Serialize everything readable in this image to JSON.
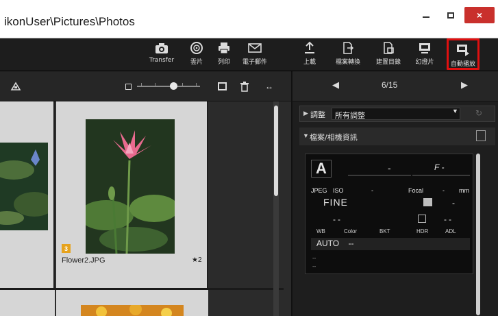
{
  "window": {
    "title": "ikonUser\\Pictures\\Photos",
    "close_glyph": "×"
  },
  "toolbar": {
    "items": [
      {
        "label": "Transfer",
        "icon": "camera-transfer-icon"
      },
      {
        "label": "雲片",
        "icon": "disc-icon"
      },
      {
        "label": "列印",
        "icon": "printer-icon"
      },
      {
        "label": "電子郵件",
        "icon": "mail-icon"
      },
      {
        "label": "上載",
        "icon": "upload-icon"
      },
      {
        "label": "檔案轉換",
        "icon": "file-convert-icon"
      },
      {
        "label": "建置目錄",
        "icon": "create-folder-icon"
      },
      {
        "label": "幻燈片",
        "icon": "slideshow-icon"
      },
      {
        "label": "自動播放",
        "icon": "autoplay-icon",
        "highlighted": true
      }
    ],
    "highlight_color": "#e01010"
  },
  "viewer": {
    "slider_level": 0.55,
    "swap_glyph": "↔"
  },
  "grid": {
    "items": [
      {
        "filename": "Flower2.JPG",
        "rating": "★2",
        "badge": "3"
      }
    ]
  },
  "nav": {
    "prev": "◀",
    "count": "6/15",
    "next": "▶"
  },
  "adjust": {
    "label": "調整",
    "value": "所有調整"
  },
  "fileinfo": {
    "label": "檔案/相機資訊",
    "mode": "A",
    "shutter": "-",
    "aperture": "F -",
    "row2": {
      "format": "JPEG",
      "iso_label": "ISO",
      "iso_value": "-",
      "focal_label": "Focal",
      "focal_value": "-",
      "focal_unit": "mm"
    },
    "quality": "FINE",
    "exp_value": "-",
    "dashes1": "--",
    "dashes2": "--",
    "headers": [
      "WB",
      "Color",
      "BKT",
      "HDR",
      "ADL"
    ],
    "wb": "AUTO",
    "wb_rest": "--",
    "misc": [
      "--",
      "--",
      "--",
      "--"
    ]
  },
  "colors": {
    "toolbar_bg": "#1d1d1d",
    "cell_bg": "#d6d6d6",
    "badge": "#e6a21c",
    "close": "#c9302c"
  }
}
